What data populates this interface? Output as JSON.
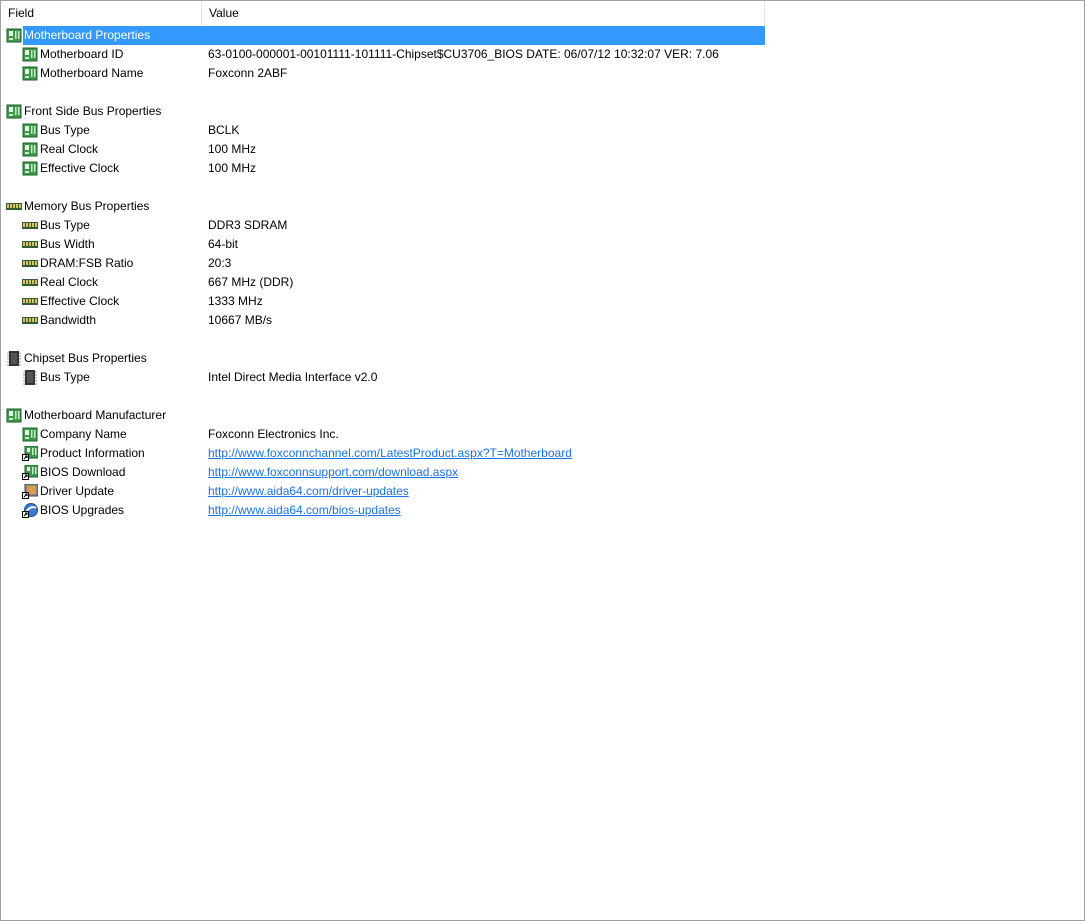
{
  "columns": {
    "field": "Field",
    "value": "Value"
  },
  "colors": {
    "selection": "#3399ff",
    "link": "#1a73e8"
  },
  "rows": [
    {
      "type": "group",
      "icon": "motherboard-icon",
      "field": "Motherboard Properties",
      "selected": true
    },
    {
      "type": "item",
      "icon": "motherboard-icon",
      "field": "Motherboard ID",
      "value": "63-0100-000001-00101111-101111-Chipset$CU3706_BIOS DATE: 06/07/12 10:32:07 VER: 7.06"
    },
    {
      "type": "item",
      "icon": "motherboard-icon",
      "field": "Motherboard Name",
      "value": "Foxconn 2ABF"
    },
    {
      "type": "blank"
    },
    {
      "type": "group",
      "icon": "motherboard-icon",
      "field": "Front Side Bus Properties"
    },
    {
      "type": "item",
      "icon": "motherboard-icon",
      "field": "Bus Type",
      "value": "BCLK"
    },
    {
      "type": "item",
      "icon": "motherboard-icon",
      "field": "Real Clock",
      "value": "100 MHz"
    },
    {
      "type": "item",
      "icon": "motherboard-icon",
      "field": "Effective Clock",
      "value": "100 MHz"
    },
    {
      "type": "blank"
    },
    {
      "type": "group",
      "icon": "memory-icon",
      "field": "Memory Bus Properties"
    },
    {
      "type": "item",
      "icon": "memory-icon",
      "field": "Bus Type",
      "value": "DDR3 SDRAM"
    },
    {
      "type": "item",
      "icon": "memory-icon",
      "field": "Bus Width",
      "value": "64-bit"
    },
    {
      "type": "item",
      "icon": "memory-icon",
      "field": "DRAM:FSB Ratio",
      "value": "20:3"
    },
    {
      "type": "item",
      "icon": "memory-icon",
      "field": "Real Clock",
      "value": "667 MHz (DDR)"
    },
    {
      "type": "item",
      "icon": "memory-icon",
      "field": "Effective Clock",
      "value": "1333 MHz"
    },
    {
      "type": "item",
      "icon": "memory-icon",
      "field": "Bandwidth",
      "value": "10667 MB/s"
    },
    {
      "type": "blank"
    },
    {
      "type": "group",
      "icon": "chip-icon",
      "field": "Chipset Bus Properties"
    },
    {
      "type": "item",
      "icon": "chip-icon",
      "field": "Bus Type",
      "value": "Intel Direct Media Interface v2.0"
    },
    {
      "type": "blank"
    },
    {
      "type": "group",
      "icon": "motherboard-icon",
      "field": "Motherboard Manufacturer"
    },
    {
      "type": "item",
      "icon": "motherboard-icon",
      "field": "Company Name",
      "value": "Foxconn Electronics Inc."
    },
    {
      "type": "item",
      "icon": "motherboard-link-icon",
      "field": "Product Information",
      "value": "http://www.foxconnchannel.com/LatestProduct.aspx?T=Motherboard",
      "link": true
    },
    {
      "type": "item",
      "icon": "motherboard-link-icon",
      "field": "BIOS Download",
      "value": "http://www.foxconnsupport.com/download.aspx",
      "link": true
    },
    {
      "type": "item",
      "icon": "driver-update-icon",
      "field": "Driver Update",
      "value": "http://www.aida64.com/driver-updates",
      "link": true
    },
    {
      "type": "item",
      "icon": "bios-upgrade-icon",
      "field": "BIOS Upgrades",
      "value": "http://www.aida64.com/bios-updates",
      "link": true
    }
  ]
}
